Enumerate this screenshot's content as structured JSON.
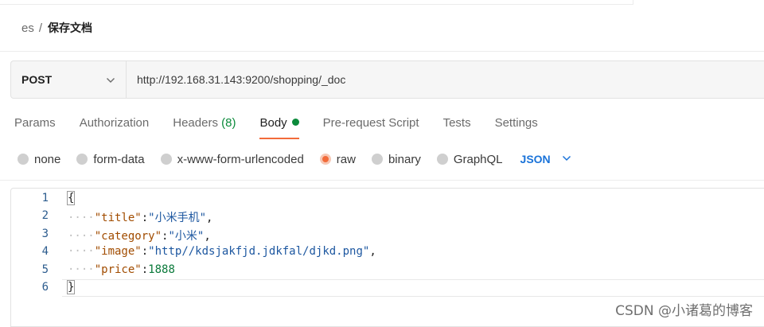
{
  "breadcrumb": {
    "parent": "es",
    "separator": "/",
    "current": "保存文档"
  },
  "request": {
    "method": "POST",
    "url": "http://192.168.31.143:9200/shopping/_doc"
  },
  "tabs": [
    {
      "label": "Params"
    },
    {
      "label": "Authorization"
    },
    {
      "label": "Headers",
      "count": "(8)"
    },
    {
      "label": "Body",
      "active": true,
      "indicator": "dot"
    },
    {
      "label": "Pre-request Script"
    },
    {
      "label": "Tests"
    },
    {
      "label": "Settings"
    }
  ],
  "body_types": [
    {
      "label": "none"
    },
    {
      "label": "form-data"
    },
    {
      "label": "x-www-form-urlencoded"
    },
    {
      "label": "raw",
      "selected": true
    },
    {
      "label": "binary"
    },
    {
      "label": "GraphQL"
    }
  ],
  "language": "JSON",
  "editor": {
    "line_numbers": [
      "1",
      "2",
      "3",
      "4",
      "5",
      "6"
    ],
    "lines": {
      "l1": "{",
      "l2_key": "\"title\"",
      "l2_colon": ":",
      "l2_val": "\"小米手机\"",
      "l2_end": ",",
      "l3_key": "\"category\"",
      "l3_colon": ":",
      "l3_val": "\"小米\"",
      "l3_end": ",",
      "l4_key": "\"image\"",
      "l4_colon": ":",
      "l4_val": "\"http//kdsjakfjd.jdkfal/djkd.png\"",
      "l4_end": ",",
      "l5_key": "\"price\"",
      "l5_colon": ":",
      "l5_val": "1888",
      "l6": "}"
    },
    "indent_dots": "····"
  },
  "watermark": "CSDN @小诸葛的博客",
  "colors": {
    "accent": "#f26b3a",
    "success": "#0b8a3b",
    "link": "#1a73d9"
  }
}
